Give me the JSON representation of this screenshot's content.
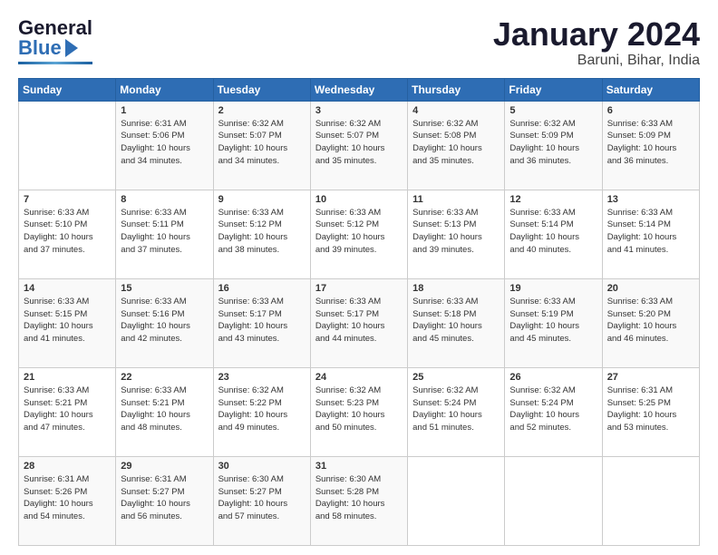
{
  "header": {
    "logo_line1": "General",
    "logo_line2": "Blue",
    "main_title": "January 2024",
    "subtitle": "Baruni, Bihar, India"
  },
  "days_of_week": [
    "Sunday",
    "Monday",
    "Tuesday",
    "Wednesday",
    "Thursday",
    "Friday",
    "Saturday"
  ],
  "weeks": [
    [
      {
        "num": "",
        "sunrise": "",
        "sunset": "",
        "daylight": ""
      },
      {
        "num": "1",
        "sunrise": "6:31 AM",
        "sunset": "5:06 PM",
        "daylight": "10 hours and 34 minutes."
      },
      {
        "num": "2",
        "sunrise": "6:32 AM",
        "sunset": "5:07 PM",
        "daylight": "10 hours and 34 minutes."
      },
      {
        "num": "3",
        "sunrise": "6:32 AM",
        "sunset": "5:07 PM",
        "daylight": "10 hours and 35 minutes."
      },
      {
        "num": "4",
        "sunrise": "6:32 AM",
        "sunset": "5:08 PM",
        "daylight": "10 hours and 35 minutes."
      },
      {
        "num": "5",
        "sunrise": "6:32 AM",
        "sunset": "5:09 PM",
        "daylight": "10 hours and 36 minutes."
      },
      {
        "num": "6",
        "sunrise": "6:33 AM",
        "sunset": "5:09 PM",
        "daylight": "10 hours and 36 minutes."
      }
    ],
    [
      {
        "num": "7",
        "sunrise": "6:33 AM",
        "sunset": "5:10 PM",
        "daylight": "10 hours and 37 minutes."
      },
      {
        "num": "8",
        "sunrise": "6:33 AM",
        "sunset": "5:11 PM",
        "daylight": "10 hours and 37 minutes."
      },
      {
        "num": "9",
        "sunrise": "6:33 AM",
        "sunset": "5:12 PM",
        "daylight": "10 hours and 38 minutes."
      },
      {
        "num": "10",
        "sunrise": "6:33 AM",
        "sunset": "5:12 PM",
        "daylight": "10 hours and 39 minutes."
      },
      {
        "num": "11",
        "sunrise": "6:33 AM",
        "sunset": "5:13 PM",
        "daylight": "10 hours and 39 minutes."
      },
      {
        "num": "12",
        "sunrise": "6:33 AM",
        "sunset": "5:14 PM",
        "daylight": "10 hours and 40 minutes."
      },
      {
        "num": "13",
        "sunrise": "6:33 AM",
        "sunset": "5:14 PM",
        "daylight": "10 hours and 41 minutes."
      }
    ],
    [
      {
        "num": "14",
        "sunrise": "6:33 AM",
        "sunset": "5:15 PM",
        "daylight": "10 hours and 41 minutes."
      },
      {
        "num": "15",
        "sunrise": "6:33 AM",
        "sunset": "5:16 PM",
        "daylight": "10 hours and 42 minutes."
      },
      {
        "num": "16",
        "sunrise": "6:33 AM",
        "sunset": "5:17 PM",
        "daylight": "10 hours and 43 minutes."
      },
      {
        "num": "17",
        "sunrise": "6:33 AM",
        "sunset": "5:17 PM",
        "daylight": "10 hours and 44 minutes."
      },
      {
        "num": "18",
        "sunrise": "6:33 AM",
        "sunset": "5:18 PM",
        "daylight": "10 hours and 45 minutes."
      },
      {
        "num": "19",
        "sunrise": "6:33 AM",
        "sunset": "5:19 PM",
        "daylight": "10 hours and 45 minutes."
      },
      {
        "num": "20",
        "sunrise": "6:33 AM",
        "sunset": "5:20 PM",
        "daylight": "10 hours and 46 minutes."
      }
    ],
    [
      {
        "num": "21",
        "sunrise": "6:33 AM",
        "sunset": "5:21 PM",
        "daylight": "10 hours and 47 minutes."
      },
      {
        "num": "22",
        "sunrise": "6:33 AM",
        "sunset": "5:21 PM",
        "daylight": "10 hours and 48 minutes."
      },
      {
        "num": "23",
        "sunrise": "6:32 AM",
        "sunset": "5:22 PM",
        "daylight": "10 hours and 49 minutes."
      },
      {
        "num": "24",
        "sunrise": "6:32 AM",
        "sunset": "5:23 PM",
        "daylight": "10 hours and 50 minutes."
      },
      {
        "num": "25",
        "sunrise": "6:32 AM",
        "sunset": "5:24 PM",
        "daylight": "10 hours and 51 minutes."
      },
      {
        "num": "26",
        "sunrise": "6:32 AM",
        "sunset": "5:24 PM",
        "daylight": "10 hours and 52 minutes."
      },
      {
        "num": "27",
        "sunrise": "6:31 AM",
        "sunset": "5:25 PM",
        "daylight": "10 hours and 53 minutes."
      }
    ],
    [
      {
        "num": "28",
        "sunrise": "6:31 AM",
        "sunset": "5:26 PM",
        "daylight": "10 hours and 54 minutes."
      },
      {
        "num": "29",
        "sunrise": "6:31 AM",
        "sunset": "5:27 PM",
        "daylight": "10 hours and 56 minutes."
      },
      {
        "num": "30",
        "sunrise": "6:30 AM",
        "sunset": "5:27 PM",
        "daylight": "10 hours and 57 minutes."
      },
      {
        "num": "31",
        "sunrise": "6:30 AM",
        "sunset": "5:28 PM",
        "daylight": "10 hours and 58 minutes."
      },
      {
        "num": "",
        "sunrise": "",
        "sunset": "",
        "daylight": ""
      },
      {
        "num": "",
        "sunrise": "",
        "sunset": "",
        "daylight": ""
      },
      {
        "num": "",
        "sunrise": "",
        "sunset": "",
        "daylight": ""
      }
    ]
  ],
  "labels": {
    "sunrise": "Sunrise:",
    "sunset": "Sunset:",
    "daylight": "Daylight:"
  }
}
